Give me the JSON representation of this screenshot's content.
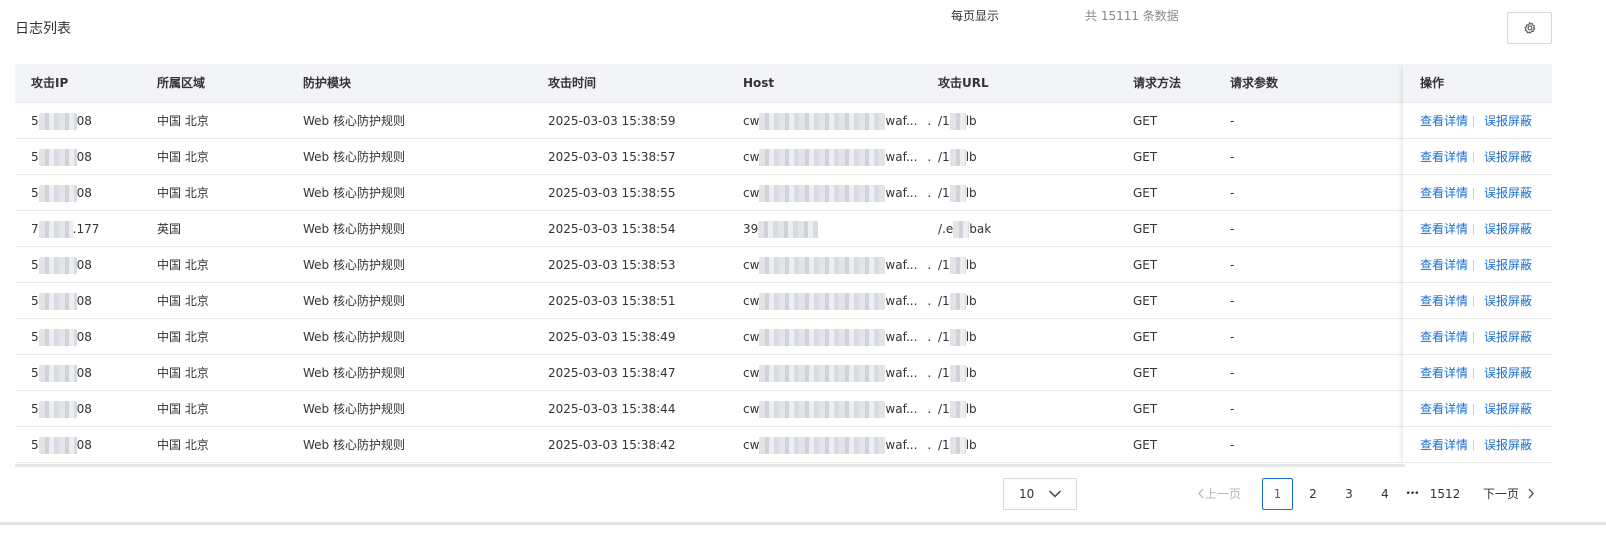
{
  "page": {
    "title": "日志列表"
  },
  "table": {
    "headers": {
      "ip": "攻击IP",
      "region": "所属区域",
      "module": "防护模块",
      "time": "攻击时间",
      "host": "Host",
      "url": "攻击URL",
      "method": "请求方法",
      "params": "请求参数",
      "ops": "操作"
    },
    "rows": [
      {
        "ip_a": "5",
        "ip_b": "08",
        "region": "中国 北京",
        "module": "Web 核心防护规则",
        "time": "2025-03-03 15:38:59",
        "host_a": "cw",
        "host_b": "waf...",
        "host_c": ".",
        "url_a": "/1",
        "url_b": "lb",
        "method": "GET",
        "params": "-"
      },
      {
        "ip_a": "5",
        "ip_b": "08",
        "region": "中国 北京",
        "module": "Web 核心防护规则",
        "time": "2025-03-03 15:38:57",
        "host_a": "cw",
        "host_b": "waf...",
        "host_c": ".",
        "url_a": "/1",
        "url_b": "lb",
        "method": "GET",
        "params": "-"
      },
      {
        "ip_a": "5",
        "ip_b": "08",
        "region": "中国 北京",
        "module": "Web 核心防护规则",
        "time": "2025-03-03 15:38:55",
        "host_a": "cw",
        "host_b": "waf...",
        "host_c": ".",
        "url_a": "/1",
        "url_b": "lb",
        "method": "GET",
        "params": "-"
      },
      {
        "ip_a": "7",
        "ip_b": ".177",
        "region": "英国",
        "module": "Web 核心防护规则",
        "time": "2025-03-03 15:38:54",
        "host_a": "39",
        "host_b": "",
        "host_c": "",
        "url_a": "/.e",
        "url_b": "bak",
        "method": "GET",
        "params": "-"
      },
      {
        "ip_a": "5",
        "ip_b": "08",
        "region": "中国 北京",
        "module": "Web 核心防护规则",
        "time": "2025-03-03 15:38:53",
        "host_a": "cw",
        "host_b": "waf...",
        "host_c": ".",
        "url_a": "/1",
        "url_b": "lb",
        "method": "GET",
        "params": "-"
      },
      {
        "ip_a": "5",
        "ip_b": "08",
        "region": "中国 北京",
        "module": "Web 核心防护规则",
        "time": "2025-03-03 15:38:51",
        "host_a": "cw",
        "host_b": "waf...",
        "host_c": ".",
        "url_a": "/1",
        "url_b": "lb",
        "method": "GET",
        "params": "-"
      },
      {
        "ip_a": "5",
        "ip_b": "08",
        "region": "中国 北京",
        "module": "Web 核心防护规则",
        "time": "2025-03-03 15:38:49",
        "host_a": "cw",
        "host_b": "waf...",
        "host_c": ".",
        "url_a": "/1",
        "url_b": "lb",
        "method": "GET",
        "params": "-"
      },
      {
        "ip_a": "5",
        "ip_b": "08",
        "region": "中国 北京",
        "module": "Web 核心防护规则",
        "time": "2025-03-03 15:38:47",
        "host_a": "cw",
        "host_b": "waf...",
        "host_c": ".",
        "url_a": "/1",
        "url_b": "lb",
        "method": "GET",
        "params": "-"
      },
      {
        "ip_a": "5",
        "ip_b": "08",
        "region": "中国 北京",
        "module": "Web 核心防护规则",
        "time": "2025-03-03 15:38:44",
        "host_a": "cw",
        "host_b": "waf...",
        "host_c": ".",
        "url_a": "/1",
        "url_b": "lb",
        "method": "GET",
        "params": "-"
      },
      {
        "ip_a": "5",
        "ip_b": "08",
        "region": "中国 北京",
        "module": "Web 核心防护规则",
        "time": "2025-03-03 15:38:42",
        "host_a": "cw",
        "host_b": "waf...",
        "host_c": ".",
        "url_a": "/1",
        "url_b": "lb",
        "method": "GET",
        "params": "-"
      }
    ],
    "actions": {
      "detail": "查看详情",
      "false_positive": "误报屏蔽"
    }
  },
  "pagination": {
    "per_page_label": "每页显示",
    "per_page_value": "10",
    "total_text": "共 15111 条数据",
    "prev": "上一页",
    "pages": [
      "1",
      "2",
      "3",
      "4"
    ],
    "ellipsis": "•••",
    "last_page": "1512",
    "next": "下一页",
    "current": "1"
  },
  "colors": {
    "link": "#1a6fd1",
    "header_bg": "#f2f4f7"
  },
  "icons": {
    "settings": "gear-icon",
    "select": "chevron-down-icon",
    "prev": "chevron-left-icon",
    "next": "chevron-right-icon"
  }
}
